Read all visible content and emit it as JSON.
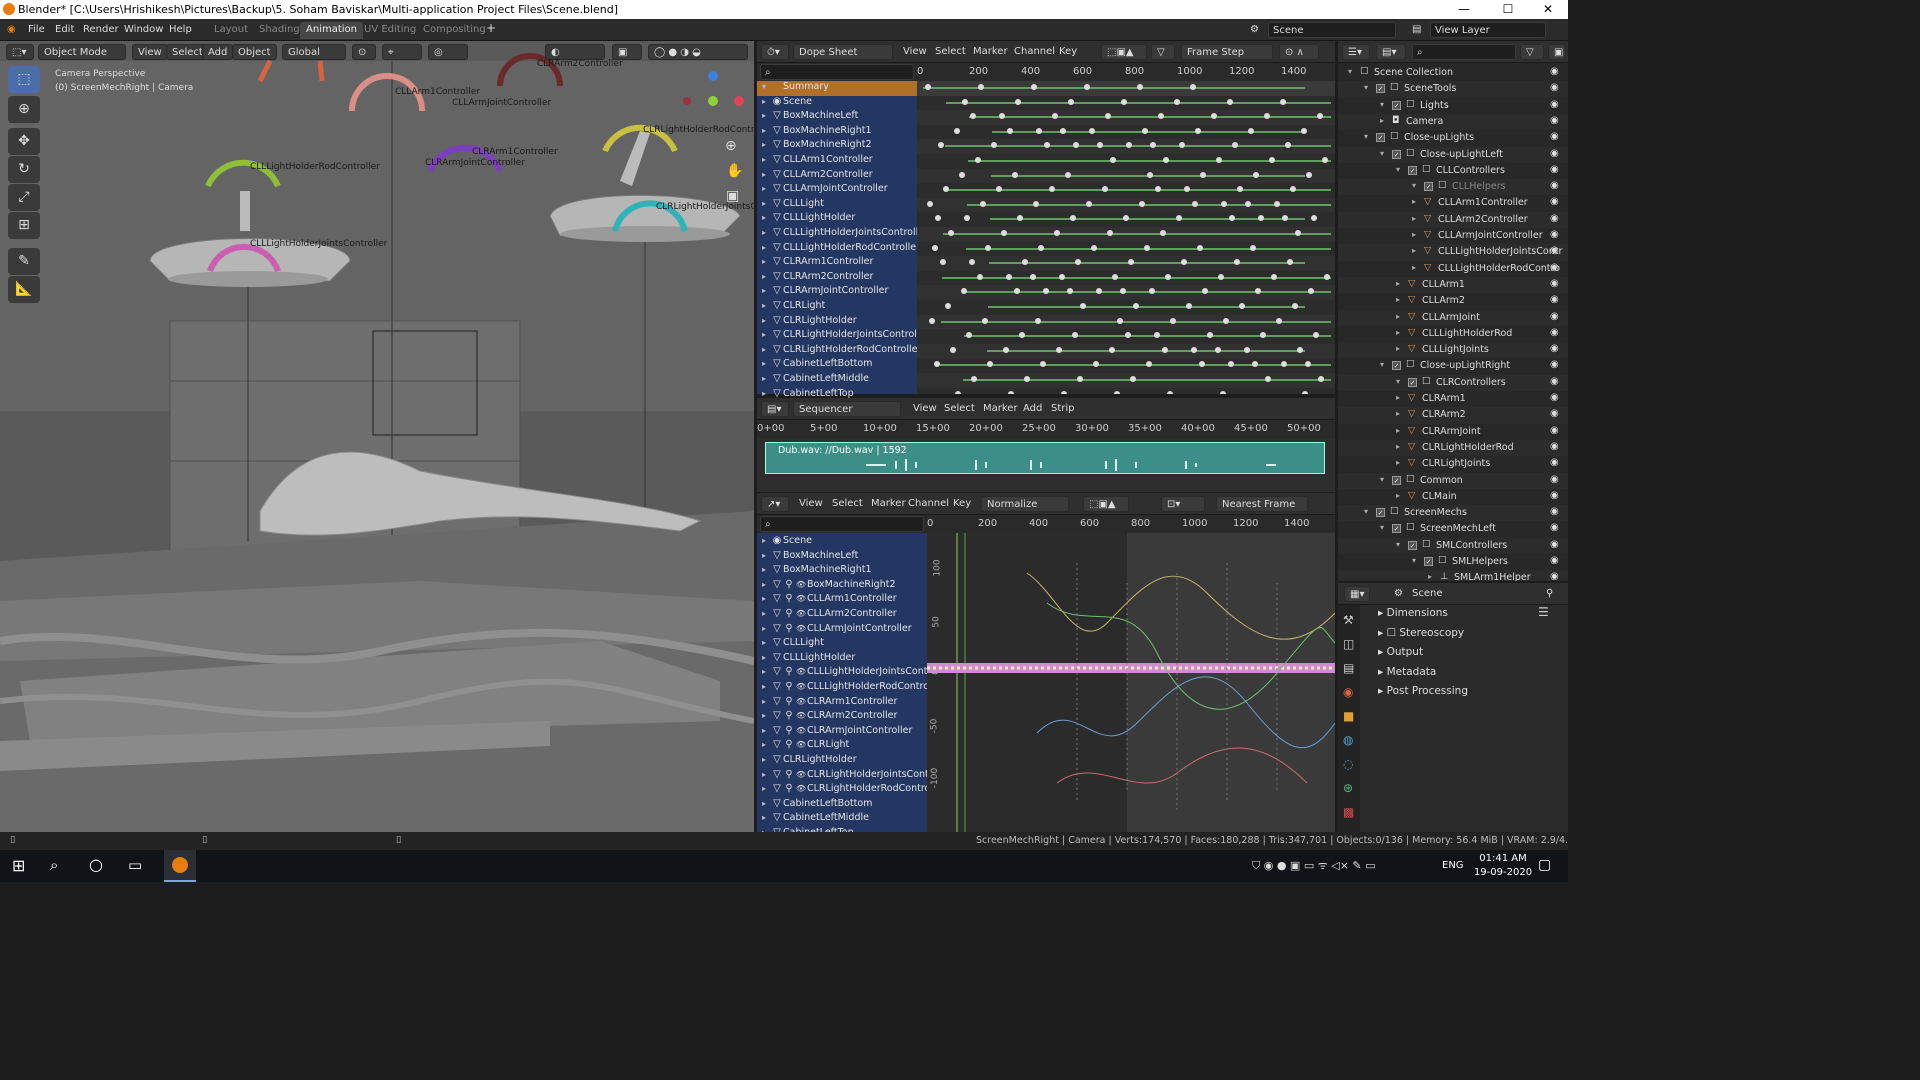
{
  "window": {
    "title": "Blender* [C:\\Users\\Hrishikesh\\Pictures\\Backup\\5. Soham Baviskar\\Multi-application Project Files\\Scene.blend]",
    "minimize": "—",
    "maximize": "☐",
    "close": "✕"
  },
  "menus": [
    "File",
    "Edit",
    "Render",
    "Window",
    "Help"
  ],
  "workspaces": [
    {
      "label": "Layout",
      "active": false
    },
    {
      "label": "Shading",
      "active": false
    },
    {
      "label": "Animation",
      "active": true
    },
    {
      "label": "UV Editing",
      "active": false
    },
    {
      "label": "Compositing",
      "active": false
    }
  ],
  "scene_field": "Scene",
  "view_layer_field": "View Layer",
  "viewport": {
    "mode": "Object Mode",
    "menus": [
      "View",
      "Select",
      "Add",
      "Object"
    ],
    "orientation": "Global",
    "info_line1": "Camera Perspective",
    "info_line2": "(0) ScreenMechRight | Camera",
    "labels": [
      "CLLArm1Controller",
      "CLLArmJointController",
      "CLRArm2Controller",
      "CLLLightHolderRodController",
      "CLRArm1Controller",
      "CLRArmJointController",
      "CLRLightHolderRodControll",
      "CLRLightHolderJointsCo",
      "CLLLightHolderJointsController"
    ]
  },
  "dopesheet": {
    "editor": "Dope Sheet",
    "menus": [
      "View",
      "Select",
      "Marker",
      "Channel",
      "Key"
    ],
    "snap": "Frame Step",
    "ruler": [
      "0",
      "200",
      "400",
      "600",
      "800",
      "1000",
      "1200",
      "1400"
    ],
    "channels": [
      "Summary",
      "Scene",
      "BoxMachineLeft",
      "BoxMachineRight1",
      "BoxMachineRight2",
      "CLLArm1Controller",
      "CLLArm2Controller",
      "CLLArmJointController",
      "CLLLight",
      "CLLLightHolder",
      "CLLLightHolderJointsController",
      "CLLLightHolderRodController",
      "CLRArm1Controller",
      "CLRArm2Controller",
      "CLRArmJointController",
      "CLRLight",
      "CLRLightHolder",
      "CLRLightHolderJointsController",
      "CLRLightHolderRodController",
      "CabinetLeftBottom",
      "CabinetLeftMiddle",
      "CabinetLeftTop"
    ]
  },
  "sequencer": {
    "editor": "Sequencer",
    "menus": [
      "View",
      "Select",
      "Marker",
      "Add",
      "Strip"
    ],
    "ruler": [
      "0+00",
      "5+00",
      "10+00",
      "15+00",
      "20+00",
      "25+00",
      "30+00",
      "35+00",
      "40+00",
      "45+00",
      "50+00"
    ],
    "strip_label": "Dub.wav: //Dub.wav | 1592"
  },
  "graph": {
    "menus": [
      "View",
      "Select",
      "Marker",
      "Channel",
      "Key"
    ],
    "normalize": "Normalize",
    "snap": "Nearest Frame",
    "ruler": [
      "0",
      "200",
      "400",
      "600",
      "800",
      "1000",
      "1200",
      "1400"
    ],
    "y_ticks": [
      "100",
      "50",
      "0",
      "-50",
      "-100"
    ],
    "channels": [
      "Scene",
      "BoxMachineLeft",
      "BoxMachineRight1",
      "BoxMachineRight2",
      "CLLArm1Controller",
      "CLLArm2Controller",
      "CLLArmJointController",
      "CLLLight",
      "CLLLightHolder",
      "CLLLightHolderJointsContro",
      "CLLLightHolderRodControlle",
      "CLRArm1Controller",
      "CLRArm2Controller",
      "CLRArmJointController",
      "CLRLight",
      "CLRLightHolder",
      "CLRLightHolderJointsContro",
      "CLRLightHolderRodControlle",
      "CabinetLeftBottom",
      "CabinetLeftMiddle",
      "CabinetLeftTop"
    ]
  },
  "outliner": {
    "items": [
      {
        "name": "Scene Collection",
        "depth": 0,
        "icon": "☐"
      },
      {
        "name": "SceneTools",
        "depth": 1,
        "icon": "☐"
      },
      {
        "name": "Lights",
        "depth": 2,
        "icon": "☐"
      },
      {
        "name": "Camera",
        "depth": 2,
        "icon": "◘"
      },
      {
        "name": "Close-upLights",
        "depth": 1,
        "icon": "☐"
      },
      {
        "name": "Close-upLightLeft",
        "depth": 2,
        "icon": "☐"
      },
      {
        "name": "CLLControllers",
        "depth": 3,
        "icon": "☐"
      },
      {
        "name": "CLLHelpers",
        "depth": 4,
        "icon": "☐"
      },
      {
        "name": "CLLArm1Controller",
        "depth": 4,
        "icon": "▽"
      },
      {
        "name": "CLLArm2Controller",
        "depth": 4,
        "icon": "▽"
      },
      {
        "name": "CLLArmJointController",
        "depth": 4,
        "icon": "▽"
      },
      {
        "name": "CLLLightHolderJointsContr",
        "depth": 4,
        "icon": "▽"
      },
      {
        "name": "CLLLightHolderRodContro",
        "depth": 4,
        "icon": "▽"
      },
      {
        "name": "CLLArm1",
        "depth": 3,
        "icon": "▽"
      },
      {
        "name": "CLLArm2",
        "depth": 3,
        "icon": "▽"
      },
      {
        "name": "CLLArmJoint",
        "depth": 3,
        "icon": "▽"
      },
      {
        "name": "CLLLightHolderRod",
        "depth": 3,
        "icon": "▽"
      },
      {
        "name": "CLLLightJoints",
        "depth": 3,
        "icon": "▽"
      },
      {
        "name": "Close-upLightRight",
        "depth": 2,
        "icon": "☐"
      },
      {
        "name": "CLRControllers",
        "depth": 3,
        "icon": "☐"
      },
      {
        "name": "CLRArm1",
        "depth": 3,
        "icon": "▽"
      },
      {
        "name": "CLRArm2",
        "depth": 3,
        "icon": "▽"
      },
      {
        "name": "CLRArmJoint",
        "depth": 3,
        "icon": "▽"
      },
      {
        "name": "CLRLightHolderRod",
        "depth": 3,
        "icon": "▽"
      },
      {
        "name": "CLRLightJoints",
        "depth": 3,
        "icon": "▽"
      },
      {
        "name": "Common",
        "depth": 2,
        "icon": "☐"
      },
      {
        "name": "CLMain",
        "depth": 3,
        "icon": "▽"
      },
      {
        "name": "ScreenMechs",
        "depth": 1,
        "icon": "☐"
      },
      {
        "name": "ScreenMechLeft",
        "depth": 2,
        "icon": "☐"
      },
      {
        "name": "SMLControllers",
        "depth": 3,
        "icon": "☐"
      },
      {
        "name": "SMLHelpers",
        "depth": 4,
        "icon": "☐"
      },
      {
        "name": "SMLArm1Helper",
        "depth": 5,
        "icon": "⊥"
      }
    ]
  },
  "properties": {
    "context": "Scene",
    "panels": [
      "Dimensions",
      "Stereoscopy",
      "Output",
      "Metadata",
      "Post Processing"
    ]
  },
  "status": {
    "text": "ScreenMechRight | Camera | Verts:174,570 | Faces:180,288 | Tris:347,701 | Objects:0/136 | Memory: 56.4 MiB | VRAM: 2.9/4.0 GiB | 2.90.0"
  },
  "taskbar": {
    "lang": "ENG",
    "time": "01:41 AM",
    "date": "19-09-2020"
  },
  "colors": {
    "accent": "#4772b3",
    "channel_bg": "#243763",
    "summary": "#b0702a",
    "strip": "#3c8f87",
    "key_line": "#5fa05f"
  }
}
